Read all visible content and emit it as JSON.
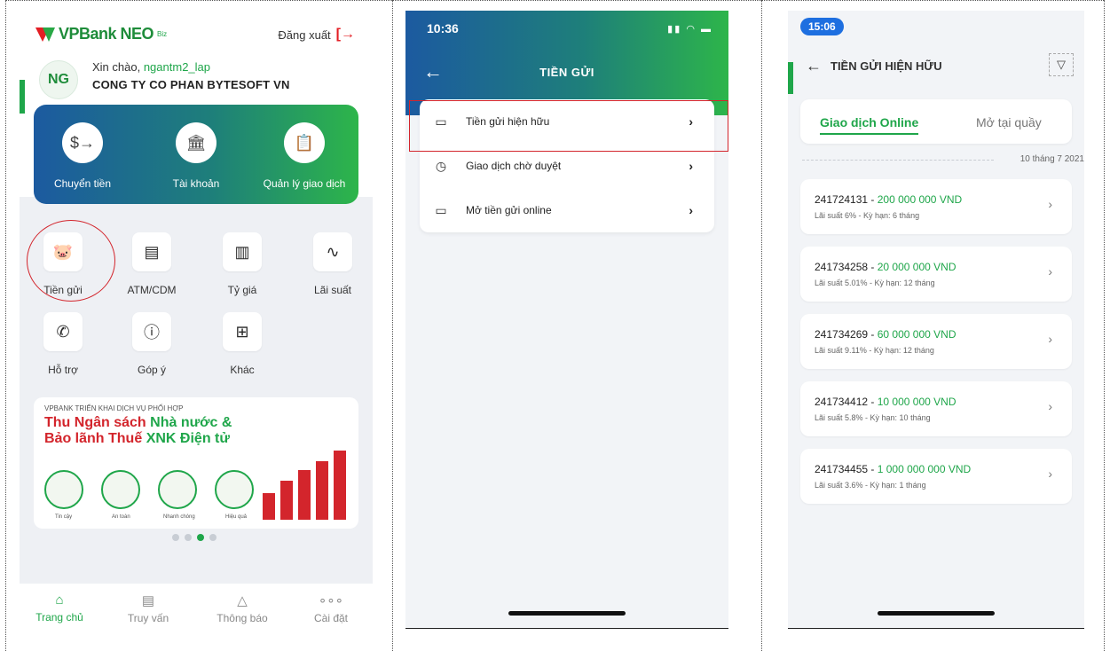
{
  "screen1": {
    "logo_text": "VPBank NEO",
    "logo_super": "Biz",
    "logout_label": "Đăng xuất",
    "avatar_initials": "NG",
    "greeting_prefix": "Xin chào,",
    "username": "ngantm2_lap",
    "company": "CONG TY CO PHAN BYTESOFT VN",
    "quick_actions": [
      {
        "label": "Chuyển tiền",
        "icon": "transfer-icon"
      },
      {
        "label": "Tài khoản",
        "icon": "bank-icon"
      },
      {
        "label": "Quản lý giao dịch",
        "icon": "transaction-manage-icon"
      }
    ],
    "grid_items": [
      {
        "label": "Tiền gửi",
        "icon": "piggy-bank-icon"
      },
      {
        "label": "ATM/CDM",
        "icon": "atm-icon"
      },
      {
        "label": "Tỷ giá",
        "icon": "exchange-rate-icon"
      },
      {
        "label": "Lãi suất",
        "icon": "interest-rate-icon"
      },
      {
        "label": "Hỗ trợ",
        "icon": "phone-icon"
      },
      {
        "label": "Góp ý",
        "icon": "info-icon"
      },
      {
        "label": "Khác",
        "icon": "more-grid-icon"
      }
    ],
    "banner": {
      "tag": "VPBANK TRIỂN KHAI DỊCH VỤ PHỐI HỢP",
      "line1_red": "Thu Ngân sách",
      "line1_green": "Nhà nước &",
      "line2_red": "Bảo lãnh Thuế",
      "line2_green": "XNK Điện tử",
      "captions": [
        "Tin cậy",
        "An toàn",
        "Nhanh chóng",
        "Hiệu quả"
      ]
    },
    "tabs": [
      {
        "label": "Trang chủ",
        "icon": "home-icon",
        "active": true
      },
      {
        "label": "Truy vấn",
        "icon": "query-icon",
        "active": false
      },
      {
        "label": "Thông báo",
        "icon": "bell-icon",
        "active": false
      },
      {
        "label": "Cài đặt",
        "icon": "more-dots-icon",
        "active": false
      }
    ]
  },
  "screen2": {
    "time": "10:36",
    "title": "TIỀN GỬI",
    "menu": [
      {
        "label": "Tiền gửi hiện hữu",
        "icon": "card-icon"
      },
      {
        "label": "Giao dịch chờ duyệt",
        "icon": "clock-icon"
      },
      {
        "label": "Mở tiền gửi online",
        "icon": "open-deposit-icon"
      }
    ]
  },
  "screen3": {
    "time": "15:06",
    "title": "TIỀN GỬI HIỆN HỮU",
    "segments": [
      "Giao dịch Online",
      "Mở tại quầy"
    ],
    "date": "10 tháng 7 2021",
    "deposits": [
      {
        "id": "241724131",
        "amount": "200 000 000 VND",
        "detail": "Lãi suất 6% - Kỳ hạn: 6 tháng"
      },
      {
        "id": "241734258",
        "amount": "20 000 000 VND",
        "detail": "Lãi suất 5.01% - Kỳ hạn: 12 tháng"
      },
      {
        "id": "241734269",
        "amount": "60 000 000 VND",
        "detail": "Lãi suất 9.11% - Kỳ hạn: 12 tháng"
      },
      {
        "id": "241734412",
        "amount": "10 000 000 VND",
        "detail": "Lãi suất 5.8% - Kỳ hạn: 10 tháng"
      },
      {
        "id": "241734455",
        "amount": "1 000 000 000 VND",
        "detail": "Lãi suất 3.6% - Kỳ hạn: 1 tháng"
      }
    ]
  },
  "colors": {
    "brand_green": "#1fa64a",
    "brand_red": "#d3252c",
    "gradient_blue": "#1c5aa0"
  }
}
